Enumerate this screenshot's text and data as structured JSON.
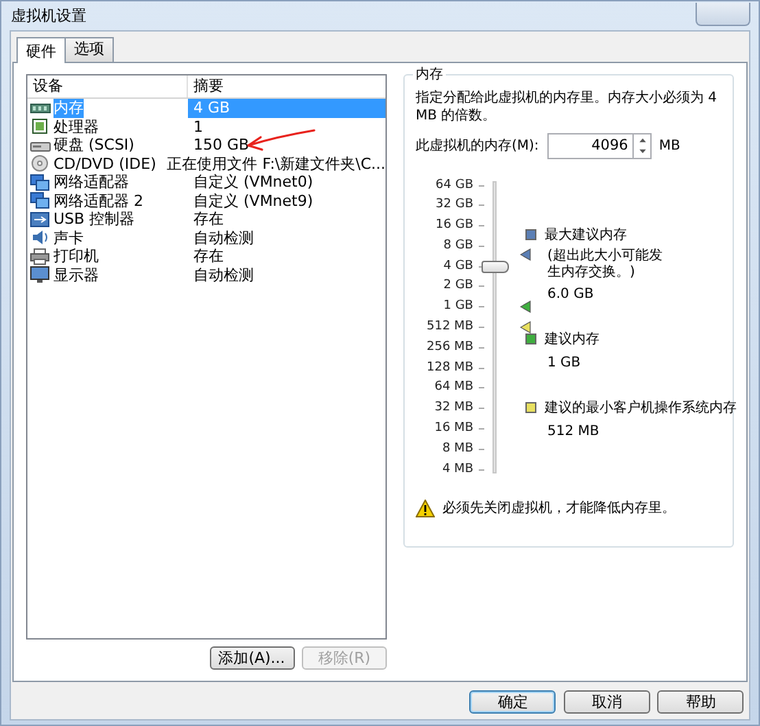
{
  "window": {
    "title": "虚拟机设置"
  },
  "tabs": [
    {
      "label": "硬件",
      "selected": true
    },
    {
      "label": "选项",
      "selected": false
    }
  ],
  "device_list": {
    "columns": [
      "设备",
      "摘要"
    ],
    "rows": [
      {
        "kind": "memory",
        "device": "内存",
        "summary": "4 GB",
        "selected": true
      },
      {
        "kind": "cpu",
        "device": "处理器",
        "summary": "1",
        "selected": false
      },
      {
        "kind": "disk",
        "device": "硬盘 (SCSI)",
        "summary": "150 GB",
        "selected": false
      },
      {
        "kind": "cd",
        "device": "CD/DVD (IDE)",
        "summary": "正在使用文件 F:\\新建文件夹\\C...",
        "selected": false
      },
      {
        "kind": "network",
        "device": "网络适配器",
        "summary": "自定义 (VMnet0)",
        "selected": false
      },
      {
        "kind": "network",
        "device": "网络适配器 2",
        "summary": "自定义 (VMnet9)",
        "selected": false
      },
      {
        "kind": "usb",
        "device": "USB 控制器",
        "summary": "存在",
        "selected": false
      },
      {
        "kind": "sound",
        "device": "声卡",
        "summary": "自动检测",
        "selected": false
      },
      {
        "kind": "printer",
        "device": "打印机",
        "summary": "存在",
        "selected": false
      },
      {
        "kind": "display",
        "device": "显示器",
        "summary": "自动检测",
        "selected": false
      }
    ]
  },
  "list_buttons": [
    {
      "label": "添加(A)...",
      "disabled": false
    },
    {
      "label": "移除(R)",
      "disabled": true
    }
  ],
  "memory": {
    "title": "内存",
    "description": "指定分配给此虚拟机的内存里。内存大小必须为 4 MB 的倍数。",
    "field_label": "此虚拟机的内存(M):",
    "value": "4096",
    "unit": "MB",
    "scale": [
      "64 GB",
      "32 GB",
      "16 GB",
      "8 GB",
      "4 GB",
      "2 GB",
      "1 GB",
      "512 MB",
      "256 MB",
      "128 MB",
      "64 MB",
      "32 MB",
      "16 MB",
      "8 MB",
      "4 MB"
    ],
    "level": 0.714,
    "legend": [
      {
        "label": "最大建议内存",
        "note": "(超出此大小可能发生内存交换。)",
        "value": "6.0 GB",
        "color": "#5b7fb5"
      },
      {
        "label": "建议内存",
        "value": "1 GB",
        "color": "#3fae3f"
      },
      {
        "label": "建议的最小客户机操作系统内存",
        "value": "512 MB",
        "color": "#e8e060"
      }
    ],
    "warning": "必须先关闭虚拟机，才能降低内存里。"
  },
  "dialog_buttons": [
    {
      "label": "确定",
      "default": true
    },
    {
      "label": "取消",
      "default": false
    },
    {
      "label": "帮助",
      "default": false
    }
  ]
}
